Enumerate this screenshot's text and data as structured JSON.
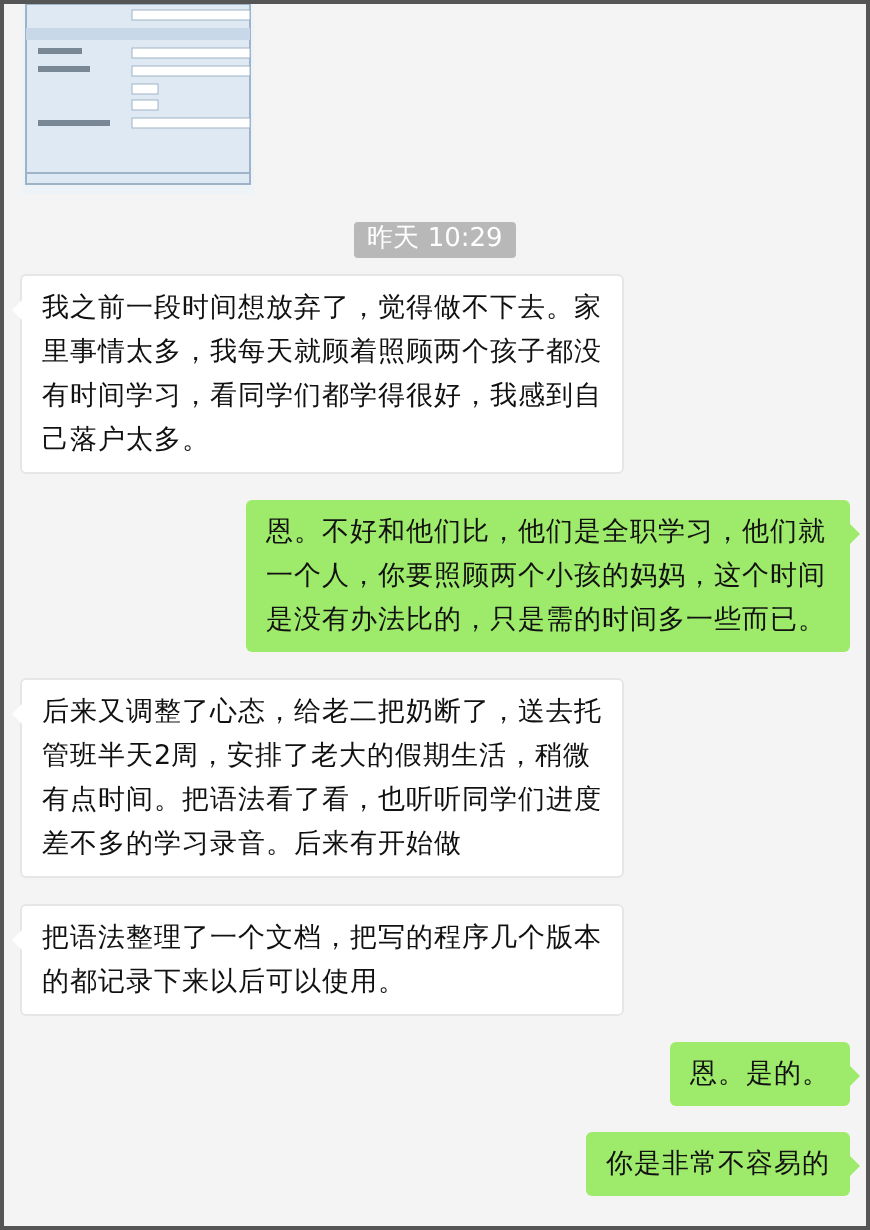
{
  "timestamp": "昨天 10:29",
  "messages": [
    {
      "kind": "received",
      "text": "我之前一段时间想放弃了，觉得做不下去。家里事情太多，我每天就顾着照顾两个孩子都没有时间学习，看同学们都学得很好，我感到自己落户太多。"
    },
    {
      "kind": "sent",
      "text": "恩。不好和他们比，他们是全职学习，他们就一个人，你要照顾两个小孩的妈妈，这个时间是没有办法比的，只是需的时间多一些而已。"
    },
    {
      "kind": "received",
      "text": "后来又调整了心态，给老二把奶断了，送去托管班半天2周，安排了老大的假期生活，稍微有点时间。把语法看了看，也听听同学们进度差不多的学习录音。后来有开始做"
    },
    {
      "kind": "received",
      "text": "把语法整理了一个文档，把写的程序几个版本的都记录下来以后可以使用。"
    },
    {
      "kind": "sent",
      "text": "恩。是的。"
    },
    {
      "kind": "sent",
      "text": "你是非常不容易的"
    }
  ]
}
